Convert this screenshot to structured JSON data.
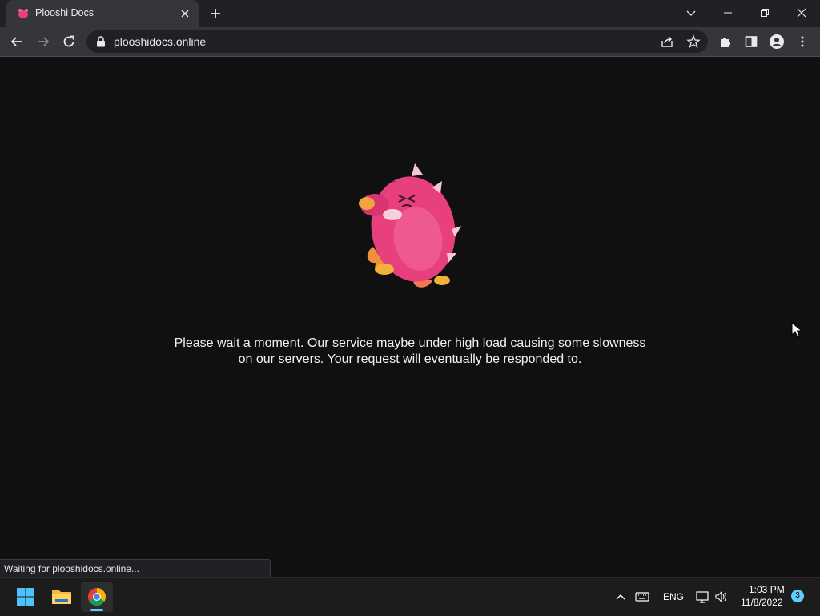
{
  "browser": {
    "tab_title": "Plooshi Docs",
    "url": "plooshidocs.online",
    "status_text": "Waiting for plooshidocs.online..."
  },
  "page": {
    "message_line1": "Please wait a moment. Our service maybe under high load causing some slowness",
    "message_line2": "on our servers. Your request will eventually be responded to.",
    "mascot_icon": "pink-plush-monster-image"
  },
  "taskbar": {
    "apps": [
      "start-menu",
      "file-explorer",
      "chrome"
    ],
    "language": "ENG",
    "time": "1:03 PM",
    "date": "11/8/2022",
    "notification_count": "3"
  },
  "colors": {
    "tab_bar": "#202124",
    "toolbar": "#35363a",
    "page_bg": "#101010",
    "accent": "#60cdff",
    "mascot_pink": "#e8407c"
  }
}
